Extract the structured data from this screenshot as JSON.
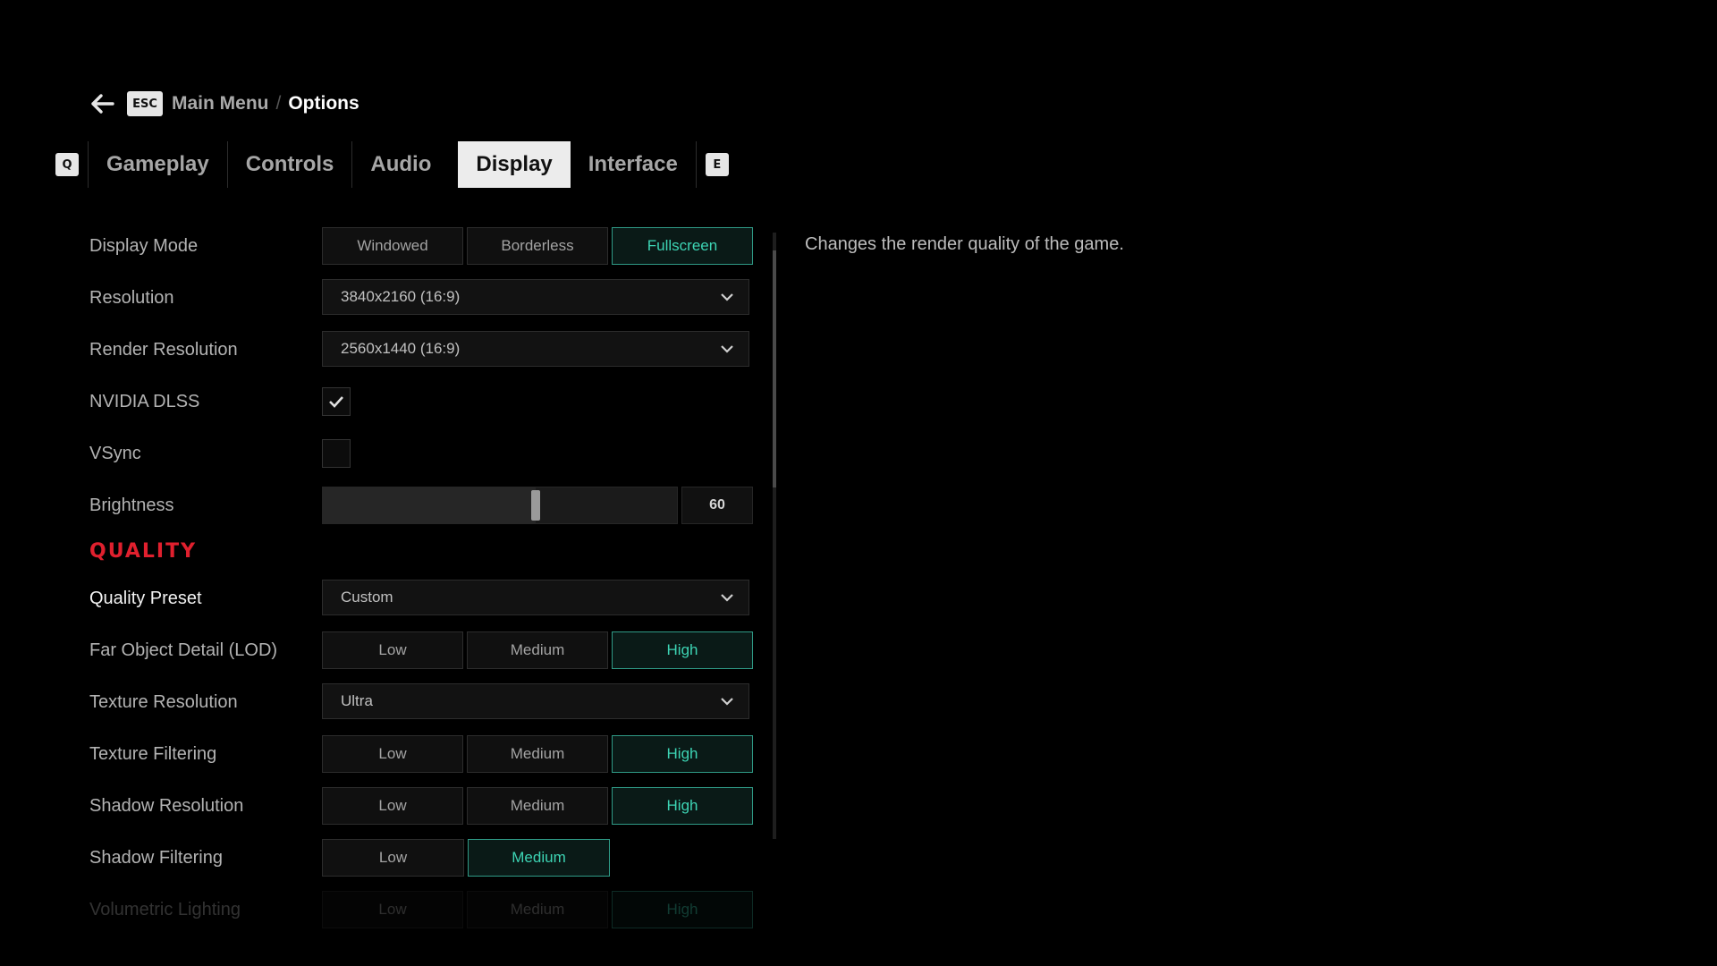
{
  "breadcrumb": {
    "back_key": "ESC",
    "parent": "Main Menu",
    "separator": "/",
    "current": "Options"
  },
  "tabs": {
    "prev_key": "Q",
    "next_key": "E",
    "items": [
      {
        "label": "Gameplay",
        "active": false
      },
      {
        "label": "Controls",
        "active": false
      },
      {
        "label": "Audio",
        "active": false
      },
      {
        "label": "Display",
        "active": true
      },
      {
        "label": "Interface",
        "active": false
      }
    ]
  },
  "settings": {
    "display_mode": {
      "label": "Display Mode",
      "options": [
        "Windowed",
        "Borderless",
        "Fullscreen"
      ],
      "selected": "Fullscreen"
    },
    "resolution": {
      "label": "Resolution",
      "value": "3840x2160 (16:9)"
    },
    "render_resolution": {
      "label": "Render Resolution",
      "value": "2560x1440 (16:9)"
    },
    "nvidia_dlss": {
      "label": "NVIDIA DLSS",
      "checked": true
    },
    "vsync": {
      "label": "VSync",
      "checked": false
    },
    "brightness": {
      "label": "Brightness",
      "value": "60",
      "fraction": 0.6
    },
    "quality_header": "QUALITY",
    "quality_preset": {
      "label": "Quality Preset",
      "value": "Custom"
    },
    "far_object_detail": {
      "label": "Far Object Detail (LOD)",
      "options": [
        "Low",
        "Medium",
        "High"
      ],
      "selected": "High"
    },
    "texture_resolution": {
      "label": "Texture Resolution",
      "value": "Ultra"
    },
    "texture_filtering": {
      "label": "Texture Filtering",
      "options": [
        "Low",
        "Medium",
        "High"
      ],
      "selected": "High"
    },
    "shadow_resolution": {
      "label": "Shadow Resolution",
      "options": [
        "Low",
        "Medium",
        "High"
      ],
      "selected": "High"
    },
    "shadow_filtering": {
      "label": "Shadow Filtering",
      "options": [
        "Low",
        "Medium"
      ],
      "selected": "Medium"
    },
    "volumetric_lighting": {
      "label": "Volumetric Lighting",
      "options": [
        "Low",
        "Medium",
        "High"
      ],
      "selected": "High"
    }
  },
  "description": "Changes the render quality of the game.",
  "colors": {
    "accent": "#3dd4b4",
    "section_header": "#e0202e",
    "background": "#000000"
  },
  "icons": {
    "back": "back-arrow-icon",
    "dropdown": "chevron-down-icon",
    "check": "checkmark-icon"
  }
}
